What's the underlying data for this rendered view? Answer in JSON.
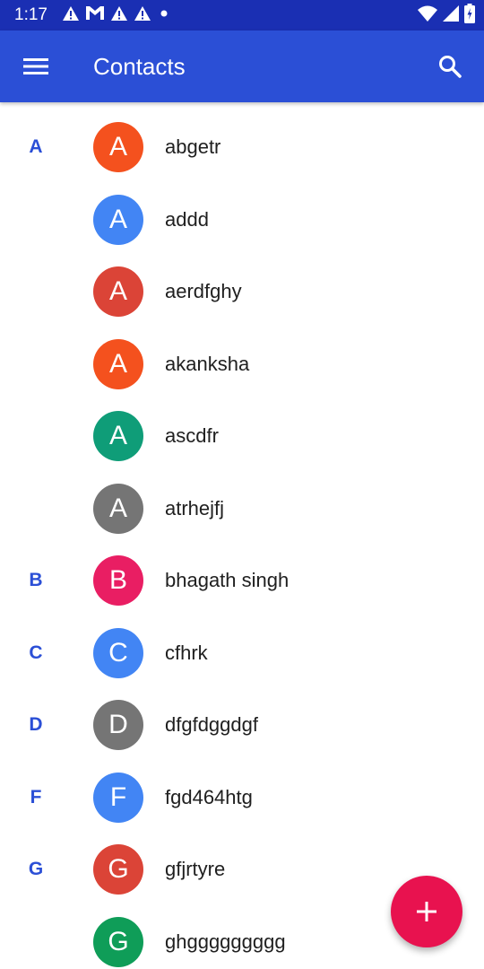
{
  "status_bar": {
    "time": "1:17",
    "notification_icons": [
      "warning-icon",
      "gmail-icon",
      "warning-icon",
      "warning-icon",
      "dot-icon"
    ],
    "right_icons": [
      "wifi-icon",
      "signal-icon",
      "battery-icon"
    ]
  },
  "app_bar": {
    "title": "Contacts",
    "color": "#2b4fd6",
    "menu_icon": "hamburger-menu-icon",
    "search_icon": "search-icon"
  },
  "contacts": [
    {
      "section": "A",
      "initial": "A",
      "name": "abgetr",
      "color": "#f4511e"
    },
    {
      "section": "",
      "initial": "A",
      "name": "addd",
      "color": "#4285f4"
    },
    {
      "section": "",
      "initial": "A",
      "name": "aerdfghy",
      "color": "#db4437"
    },
    {
      "section": "",
      "initial": "A",
      "name": "akanksha",
      "color": "#f4511e"
    },
    {
      "section": "",
      "initial": "A",
      "name": "ascdfr",
      "color": "#0f9d78"
    },
    {
      "section": "",
      "initial": "A",
      "name": "atrhejfj",
      "color": "#757575"
    },
    {
      "section": "B",
      "initial": "B",
      "name": "bhagath singh",
      "color": "#e91e63"
    },
    {
      "section": "C",
      "initial": "C",
      "name": "cfhrk",
      "color": "#4285f4"
    },
    {
      "section": "D",
      "initial": "D",
      "name": "dfgfdggdgf",
      "color": "#757575"
    },
    {
      "section": "F",
      "initial": "F",
      "name": "fgd464htg",
      "color": "#4285f4"
    },
    {
      "section": "G",
      "initial": "G",
      "name": "gfjrtyre",
      "color": "#db4437"
    },
    {
      "section": "",
      "initial": "G",
      "name": "ghggggggggg",
      "color": "#0f9d58"
    }
  ],
  "fab": {
    "icon": "plus-icon",
    "color": "#e8124f"
  }
}
